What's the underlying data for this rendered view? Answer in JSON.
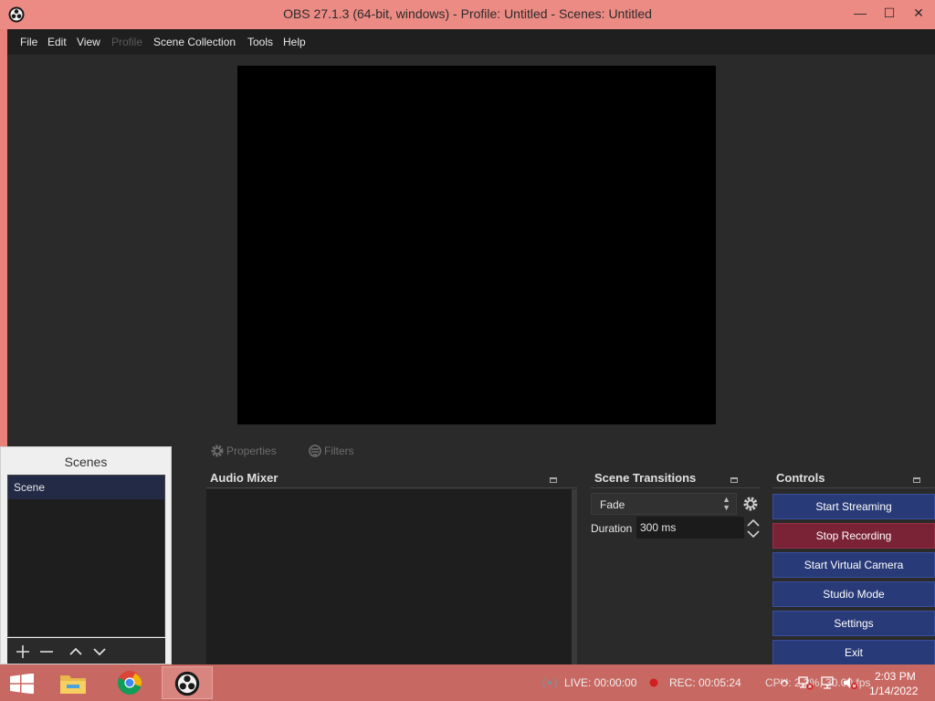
{
  "window": {
    "title": "OBS 27.1.3 (64-bit, windows) - Profile: Untitled - Scenes: Untitled",
    "min_glyph": "—",
    "max_glyph": "☐",
    "close_glyph": "✕"
  },
  "menu": {
    "file": "File",
    "edit": "Edit",
    "view": "View",
    "profile": "Profile",
    "scene_collection": "Scene Collection",
    "tools": "Tools",
    "help": "Help"
  },
  "toolbar": {
    "properties": "Properties",
    "filters": "Filters"
  },
  "docks": {
    "audio_mixer": "Audio Mixer",
    "scene_transitions": "Scene Transitions",
    "controls": "Controls"
  },
  "transitions": {
    "selected": "Fade",
    "duration_label": "Duration",
    "duration_value": "300 ms"
  },
  "controls": {
    "start_streaming": "Start Streaming",
    "stop_recording": "Stop Recording",
    "start_virtual_camera": "Start Virtual Camera",
    "studio_mode": "Studio Mode",
    "settings": "Settings",
    "exit": "Exit"
  },
  "scenes": {
    "title": "Scenes",
    "items": [
      {
        "label": "Scene"
      }
    ]
  },
  "status": {
    "live": "LIVE: 00:00:00",
    "rec": "REC: 00:05:24",
    "cpu": "CPU: 2.3%, 30.00 fps"
  },
  "clock": {
    "time": "2:03 PM",
    "date": "1/14/2022"
  },
  "colors": {
    "accent_button": "#293a78",
    "recording_button": "#7a2236",
    "window_frame": "#ec8b84"
  },
  "icons": {
    "app": "obs-icon",
    "start": "windows-start-icon",
    "explorer": "file-explorer-icon",
    "browser": "chrome-icon",
    "settings": "gear-icon"
  }
}
